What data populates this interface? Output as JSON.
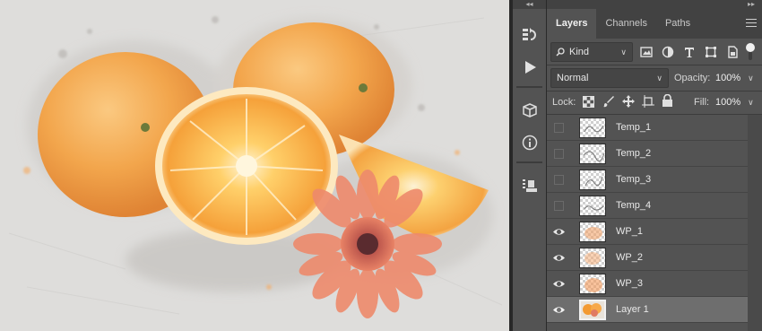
{
  "panel": {
    "tabs": [
      {
        "label": "Layers",
        "active": true
      },
      {
        "label": "Channels",
        "active": false
      },
      {
        "label": "Paths",
        "active": false
      }
    ],
    "filter": {
      "label": "Kind"
    },
    "blend_mode": "Normal",
    "opacity": {
      "label": "Opacity:",
      "value": "100%"
    },
    "lock": {
      "label": "Lock:"
    },
    "fill": {
      "label": "Fill:",
      "value": "100%"
    },
    "layers": [
      {
        "name": "Temp_1",
        "visible": false,
        "selected": false,
        "thumb": "sketch"
      },
      {
        "name": "Temp_2",
        "visible": false,
        "selected": false,
        "thumb": "sketch"
      },
      {
        "name": "Temp_3",
        "visible": false,
        "selected": false,
        "thumb": "sketch"
      },
      {
        "name": "Temp_4",
        "visible": false,
        "selected": false,
        "thumb": "sketch"
      },
      {
        "name": "WP_1",
        "visible": true,
        "selected": false,
        "thumb": "paint"
      },
      {
        "name": "WP_2",
        "visible": true,
        "selected": false,
        "thumb": "paint"
      },
      {
        "name": "WP_3",
        "visible": true,
        "selected": false,
        "thumb": "paint"
      },
      {
        "name": "Layer 1",
        "visible": true,
        "selected": true,
        "thumb": "photo"
      }
    ]
  },
  "tools": [
    "history-icon",
    "play-icon",
    "3d-icon",
    "info-icon",
    "properties-icon"
  ],
  "colors": {
    "panel_bg": "#535353",
    "tab_bar": "#424242",
    "selected_row": "#6e6e6e",
    "orange": "#f39a32"
  }
}
